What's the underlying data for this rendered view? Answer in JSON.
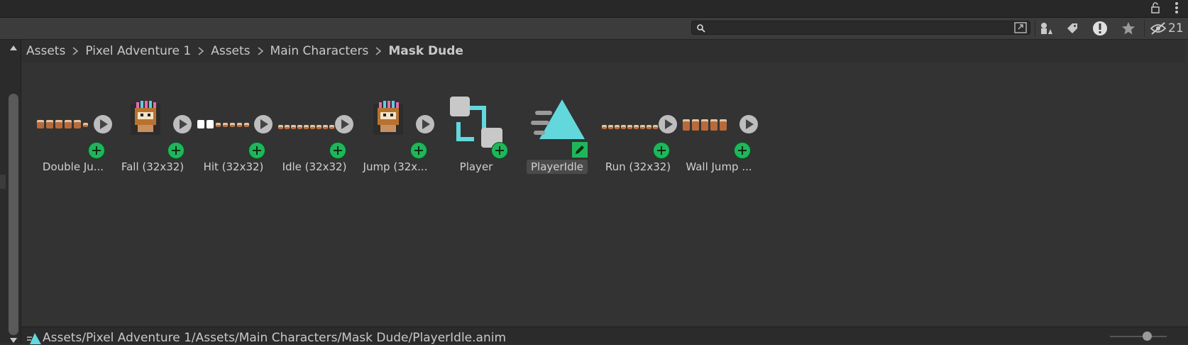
{
  "window": {
    "top_icons": [
      "lock-icon",
      "kebab-menu-icon"
    ]
  },
  "toolbar": {
    "search": {
      "value": "",
      "placeholder": ""
    },
    "buttons": [
      {
        "name": "search-by-type-button",
        "icon": "shapes-icon"
      },
      {
        "name": "search-by-label-button",
        "icon": "tag-icon"
      },
      {
        "name": "log-types-button",
        "icon": "exclamation-icon"
      },
      {
        "name": "favorites-button",
        "icon": "star-icon"
      }
    ],
    "hidden_count": "21"
  },
  "breadcrumb": {
    "items": [
      {
        "label": "Assets"
      },
      {
        "label": "Pixel Adventure 1"
      },
      {
        "label": "Assets"
      },
      {
        "label": "Main Characters"
      },
      {
        "label": "Mask Dude",
        "current": true
      }
    ]
  },
  "assets": [
    {
      "label": "Double Ju...",
      "kind": "spritesheet",
      "selected": false
    },
    {
      "label": "Fall (32x32)",
      "kind": "sprite",
      "selected": false
    },
    {
      "label": "Hit (32x32)",
      "kind": "spritesheet",
      "selected": false
    },
    {
      "label": "Idle (32x32)",
      "kind": "spritesheet",
      "selected": false
    },
    {
      "label": "Jump (32x...",
      "kind": "sprite",
      "selected": false
    },
    {
      "label": "Player",
      "kind": "animator-controller",
      "selected": false
    },
    {
      "label": "PlayerIdle",
      "kind": "animation-clip",
      "selected": true
    },
    {
      "label": "Run (32x32)",
      "kind": "spritesheet",
      "selected": false
    },
    {
      "label": "Wall Jump ...",
      "kind": "spritesheet",
      "selected": false
    }
  ],
  "status": {
    "path": "Assets/Pixel Adventure 1/Assets/Main Characters/Mask Dude/PlayerIdle.anim",
    "zoom_fraction": 0.6
  },
  "colors": {
    "accent_cyan": "#62d8dc",
    "add_green": "#1fb65a",
    "background": "#323232"
  }
}
